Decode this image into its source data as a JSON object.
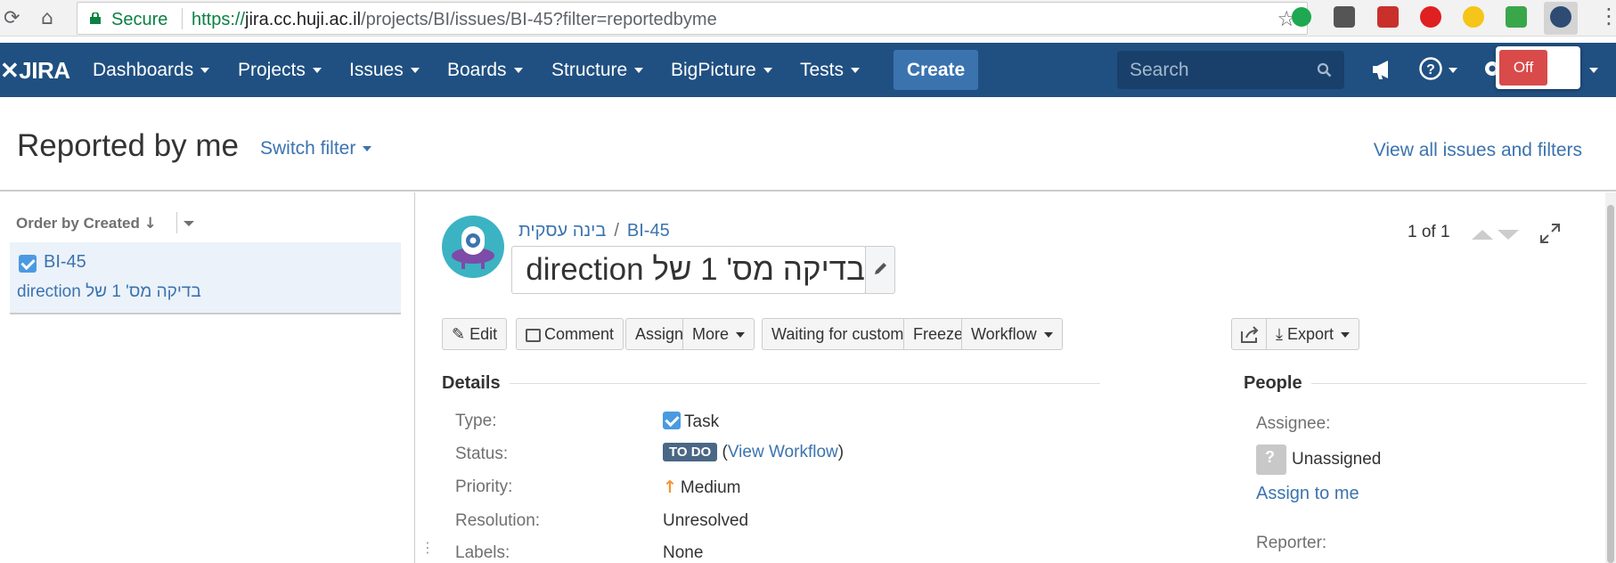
{
  "browser": {
    "secure_label": "Secure",
    "url_protocol": "https://",
    "url_host": "jira.cc.huji.ac.il",
    "url_path": "/projects/BI/issues/BI-45?filter=reportedbyme"
  },
  "nav": {
    "logo": "JIRA",
    "items": [
      "Dashboards",
      "Projects",
      "Issues",
      "Boards",
      "Structure",
      "BigPicture",
      "Tests"
    ],
    "create_label": "Create",
    "search_placeholder": "Search",
    "toggle_label": "Off"
  },
  "page": {
    "title": "Reported by me",
    "switch_filter": "Switch filter",
    "view_all": "View all issues and filters"
  },
  "issue_list": {
    "order_by": "Order by Created",
    "items": [
      {
        "key": "BI-45",
        "summary": "בדיקה מס' 1 של direction"
      }
    ]
  },
  "issue": {
    "project": "בינה עסקית",
    "key": "BI-45",
    "summary": "בדיקה מס' 1 של direction",
    "pager": "1 of 1"
  },
  "toolbar": {
    "edit": "Edit",
    "comment": "Comment",
    "assign": "Assign",
    "more": "More",
    "waiting": "Waiting for customer",
    "freeze": "Freeze",
    "workflow": "Workflow",
    "export": "Export"
  },
  "details": {
    "heading": "Details",
    "type_label": "Type:",
    "type_value": "Task",
    "status_label": "Status:",
    "status_value": "TO DO",
    "view_workflow": "View Workflow",
    "priority_label": "Priority:",
    "priority_value": "Medium",
    "resolution_label": "Resolution:",
    "resolution_value": "Unresolved",
    "labels_label": "Labels:",
    "labels_value": "None"
  },
  "people": {
    "heading": "People",
    "assignee_label": "Assignee:",
    "assignee_value": "Unassigned",
    "assign_to_me": "Assign to me",
    "reporter_label": "Reporter:"
  },
  "colors": {
    "nav_bg": "#205081",
    "link": "#3b73af",
    "status_lozenge": "#4a6785",
    "priority_medium": "#f79232"
  }
}
